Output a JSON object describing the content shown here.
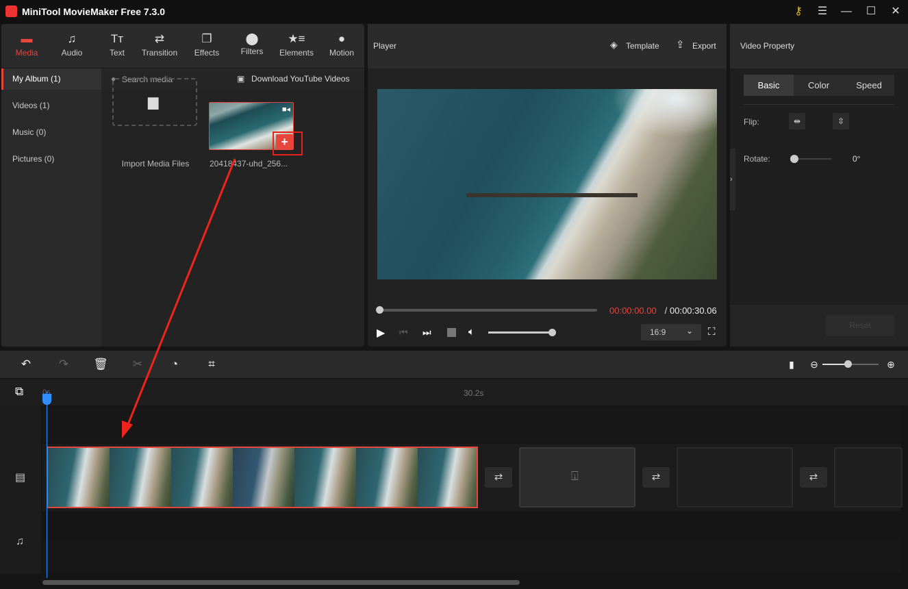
{
  "app": {
    "title": "MiniTool MovieMaker Free 7.3.0",
    "icons": [
      "key-icon",
      "menu-icon",
      "minimize-icon",
      "maximize-icon",
      "close-icon"
    ]
  },
  "tabs": [
    {
      "label": "Media",
      "icon": "folder"
    },
    {
      "label": "Audio",
      "icon": "music-note"
    },
    {
      "label": "Text",
      "icon": "text"
    },
    {
      "label": "Transition",
      "icon": "swap"
    },
    {
      "label": "Effects",
      "icon": "layers"
    },
    {
      "label": "Filters",
      "icon": "circles"
    },
    {
      "label": "Elements",
      "icon": "star-list"
    },
    {
      "label": "Motion",
      "icon": "ball"
    }
  ],
  "sidebar": [
    {
      "label": "My Album (1)",
      "active": true
    },
    {
      "label": "Videos (1)"
    },
    {
      "label": "Music (0)"
    },
    {
      "label": "Pictures (0)"
    }
  ],
  "media": {
    "search_placeholder": "Search media",
    "download_label": "Download YouTube Videos",
    "import_label": "Import Media Files",
    "clip_name": "20418437-uhd_256..."
  },
  "player": {
    "title": "Player",
    "template_label": "Template",
    "export_label": "Export",
    "current_time": "00:00:00.00",
    "separator": " / ",
    "total_time": "00:00:30.06",
    "aspect": "16:9",
    "progress": 0,
    "volume": 1.0
  },
  "property": {
    "title": "Video Property",
    "tabs": [
      "Basic",
      "Color",
      "Speed"
    ],
    "active_tab": "Basic",
    "flip_label": "Flip:",
    "rotate_label": "Rotate:",
    "rotate_value": "0°",
    "reset_label": "Reset"
  },
  "timeline": {
    "start_label": "0s",
    "end_label": "30.2s",
    "zoom_level": 0.6,
    "accent": "#e8453c",
    "playhead": "#2f8fff"
  }
}
